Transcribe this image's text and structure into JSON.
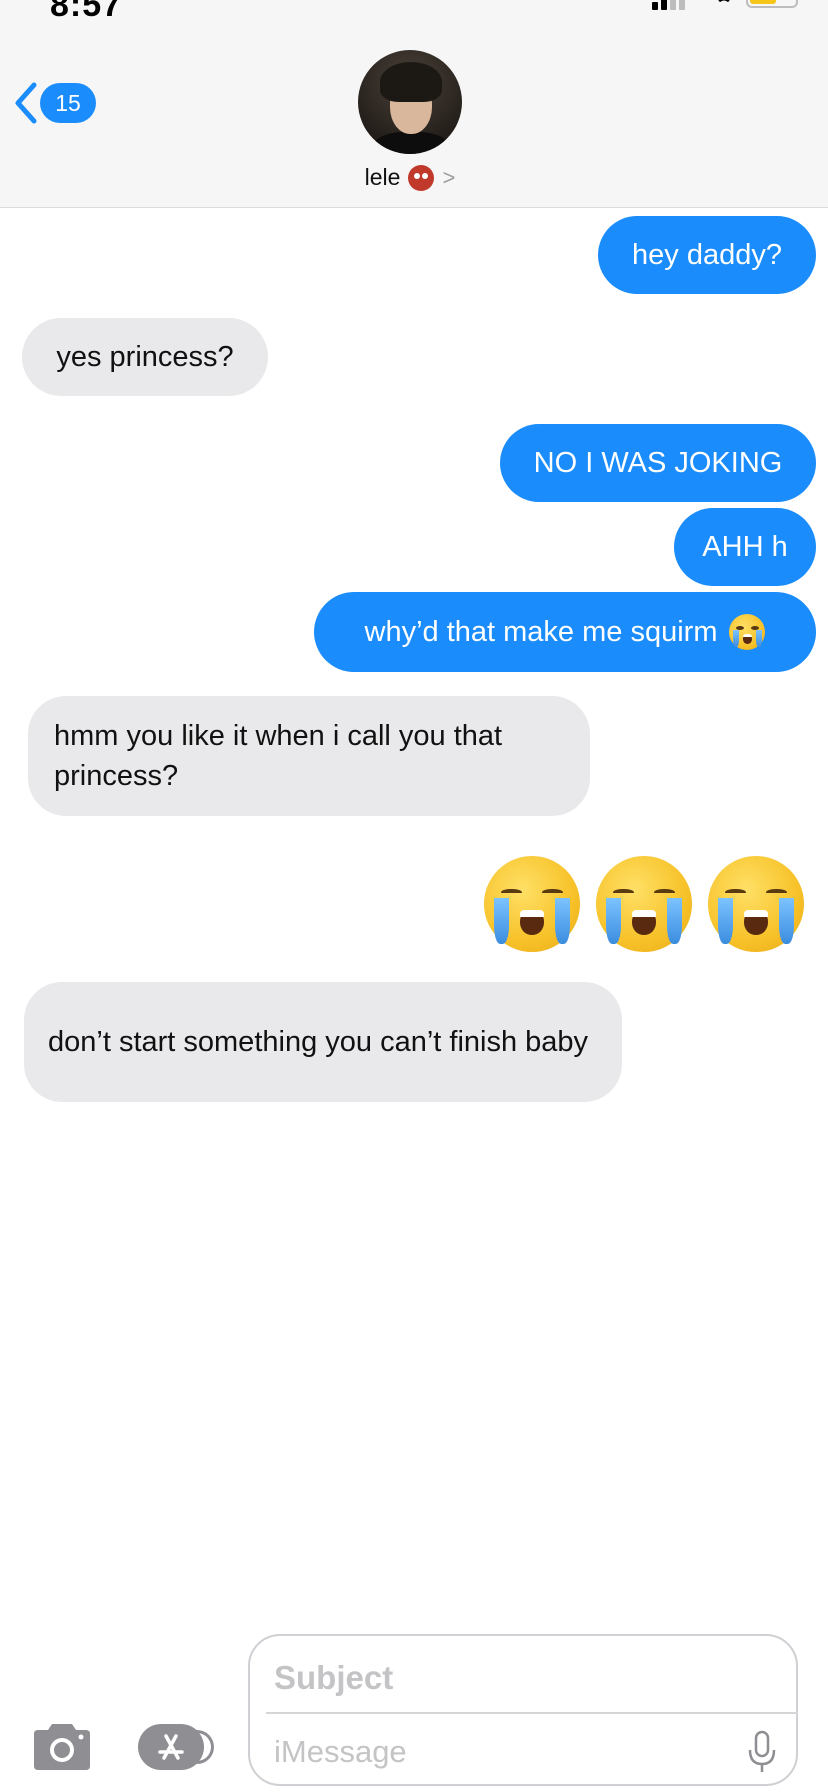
{
  "status_bar": {
    "time": "8:57"
  },
  "header": {
    "back_badge": "15",
    "contact_name": "lele",
    "contact_emoji": "oni-mask-icon",
    "chevron": ">"
  },
  "messages": [
    {
      "from": "me",
      "text": "hey daddy?"
    },
    {
      "from": "them",
      "text": "yes princess?"
    },
    {
      "from": "me",
      "text": "NO I WAS JOKING"
    },
    {
      "from": "me",
      "text": "AHH h"
    },
    {
      "from": "me",
      "text": "why’d that make me squirm",
      "emoji": "loudly-crying-face"
    },
    {
      "from": "them",
      "text": "hmm you like it when i call you that princess?"
    },
    {
      "from": "me",
      "emoji_only": [
        "loudly-crying-face",
        "loudly-crying-face",
        "loudly-crying-face"
      ]
    },
    {
      "from": "them",
      "text": "don’t start something you can’t finish baby"
    }
  ],
  "input": {
    "subject_placeholder": "Subject",
    "message_placeholder": "iMessage"
  },
  "colors": {
    "sent_bubble": "#1a8cfb",
    "received_bubble": "#e9e9eb",
    "header_bg": "#f6f6f6"
  }
}
